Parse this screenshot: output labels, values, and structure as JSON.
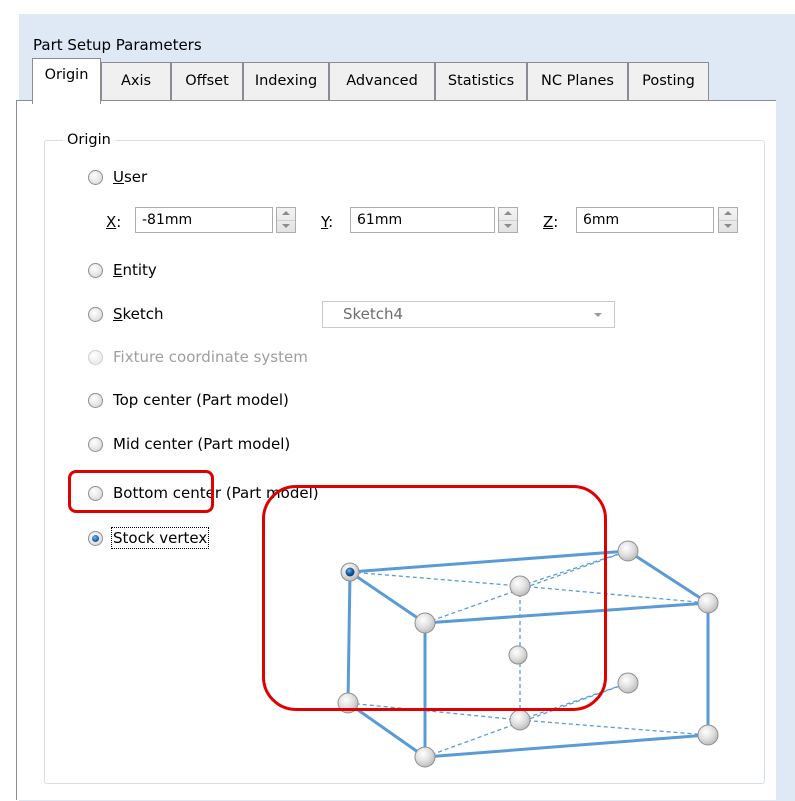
{
  "window": {
    "title": "Part Setup Parameters"
  },
  "tabs": [
    {
      "label": "Origin",
      "active": true
    },
    {
      "label": "Axis",
      "active": false
    },
    {
      "label": "Offset",
      "active": false
    },
    {
      "label": "Indexing",
      "active": false
    },
    {
      "label": "Advanced",
      "active": false
    },
    {
      "label": "Statistics",
      "active": false
    },
    {
      "label": "NC Planes",
      "active": false
    },
    {
      "label": "Posting",
      "active": false
    }
  ],
  "origin_group": {
    "label": "Origin",
    "options": {
      "user": {
        "mnemonic": "U",
        "rest": "ser",
        "checked": false
      },
      "entity": {
        "mnemonic": "E",
        "rest": "ntity",
        "checked": false
      },
      "sketch": {
        "mnemonic": "S",
        "rest": "ketch",
        "checked": false
      },
      "fixture": {
        "label": "Fixture coordinate system",
        "enabled": false
      },
      "top_center": {
        "label": "Top center (Part model)",
        "checked": false
      },
      "mid_center": {
        "label": "Mid center (Part model)",
        "checked": false
      },
      "bottom_center": {
        "label": "Bottom center (Part model)",
        "checked": false
      },
      "stock_vertex": {
        "label": "Stock vertex",
        "checked": true
      }
    },
    "coords": {
      "x": {
        "mnemonic": "X",
        "value": "-81mm"
      },
      "y": {
        "mnemonic": "Y",
        "value": "61mm"
      },
      "z": {
        "mnemonic": "Z",
        "value": "6mm"
      }
    },
    "sketch_select": {
      "value": "Sketch4",
      "enabled": false
    }
  },
  "colors": {
    "highlight": "#e10000",
    "cube_edge": "#5b9bd5",
    "accent": "#1b5ea8"
  }
}
